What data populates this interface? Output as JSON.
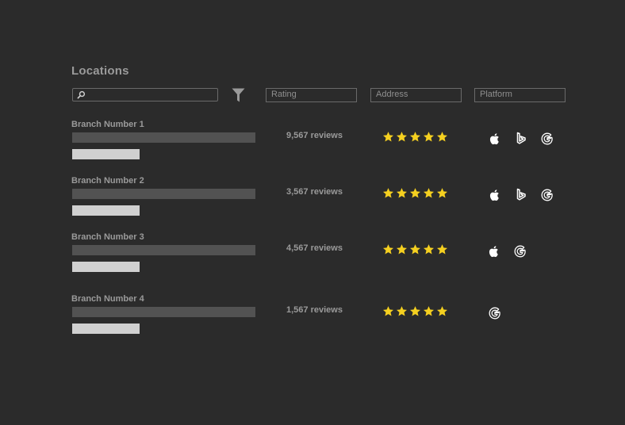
{
  "page": {
    "title": "Locations"
  },
  "search": {
    "placeholder": ""
  },
  "columns": {
    "rating": "Rating",
    "address": "Address",
    "platform": "Platform"
  },
  "colors": {
    "background": "#2b2b2b",
    "star": "#f5d020",
    "text": "#9a9a9a"
  },
  "rows": [
    {
      "name": "Branch Number 1",
      "reviews": "9,567 reviews",
      "stars": 5,
      "platforms": [
        "apple-icon",
        "bing-icon",
        "google-icon"
      ]
    },
    {
      "name": "Branch Number 2",
      "reviews": "3,567 reviews",
      "stars": 5,
      "platforms": [
        "apple-icon",
        "bing-icon",
        "google-icon"
      ]
    },
    {
      "name": "Branch Number 3",
      "reviews": "4,567 reviews",
      "stars": 5,
      "platforms": [
        "apple-icon",
        "google-icon"
      ]
    },
    {
      "name": "Branch Number 4",
      "reviews": "1,567 reviews",
      "stars": 5,
      "platforms": [
        "google-icon"
      ]
    }
  ]
}
